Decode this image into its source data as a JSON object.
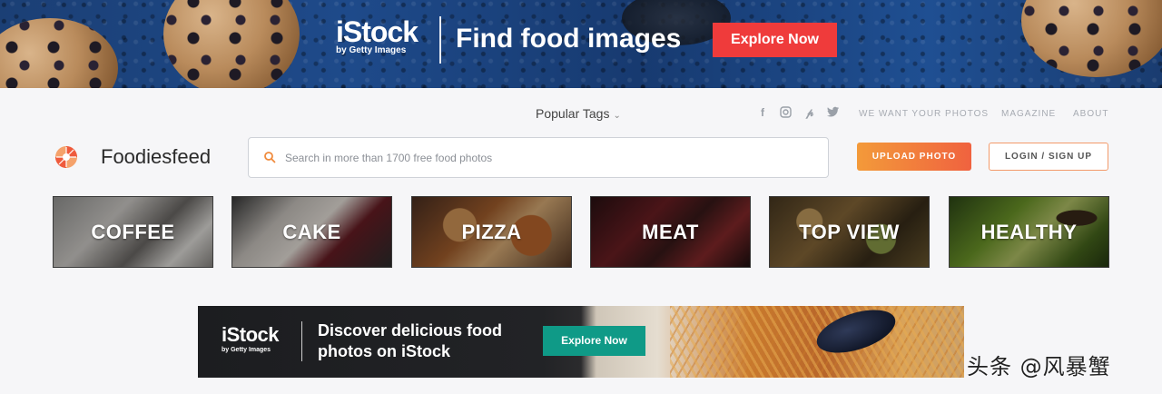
{
  "top_banner": {
    "brand": "iStock",
    "brand_sub": "by Getty Images",
    "headline": "Find food images",
    "cta": "Explore Now"
  },
  "nav": {
    "popular_tags": "Popular Tags",
    "social_icons": [
      "facebook-icon",
      "instagram-icon",
      "pinterest-icon",
      "twitter-icon"
    ],
    "links": [
      "WE WANT YOUR PHOTOS",
      "MAGAZINE",
      "ABOUT"
    ]
  },
  "header": {
    "site_name": "Foodiesfeed",
    "search_placeholder": "Search in more than 1700 free food photos",
    "upload_label": "UPLOAD PHOTO",
    "login_label": "LOGIN / SIGN UP"
  },
  "categories": [
    "COFFEE",
    "CAKE",
    "PIZZA",
    "MEAT",
    "TOP VIEW",
    "HEALTHY"
  ],
  "bottom_banner": {
    "brand": "iStock",
    "brand_sub": "by Getty Images",
    "headline": "Discover delicious food photos on iStock",
    "cta": "Explore Now"
  },
  "watermark": "头条 @风暴蟹",
  "colors": {
    "banner_cta": "#ef3b3b",
    "upload_gradient_start": "#f39a3a",
    "upload_gradient_end": "#f0623f",
    "bottom_cta": "#0f9a87"
  }
}
